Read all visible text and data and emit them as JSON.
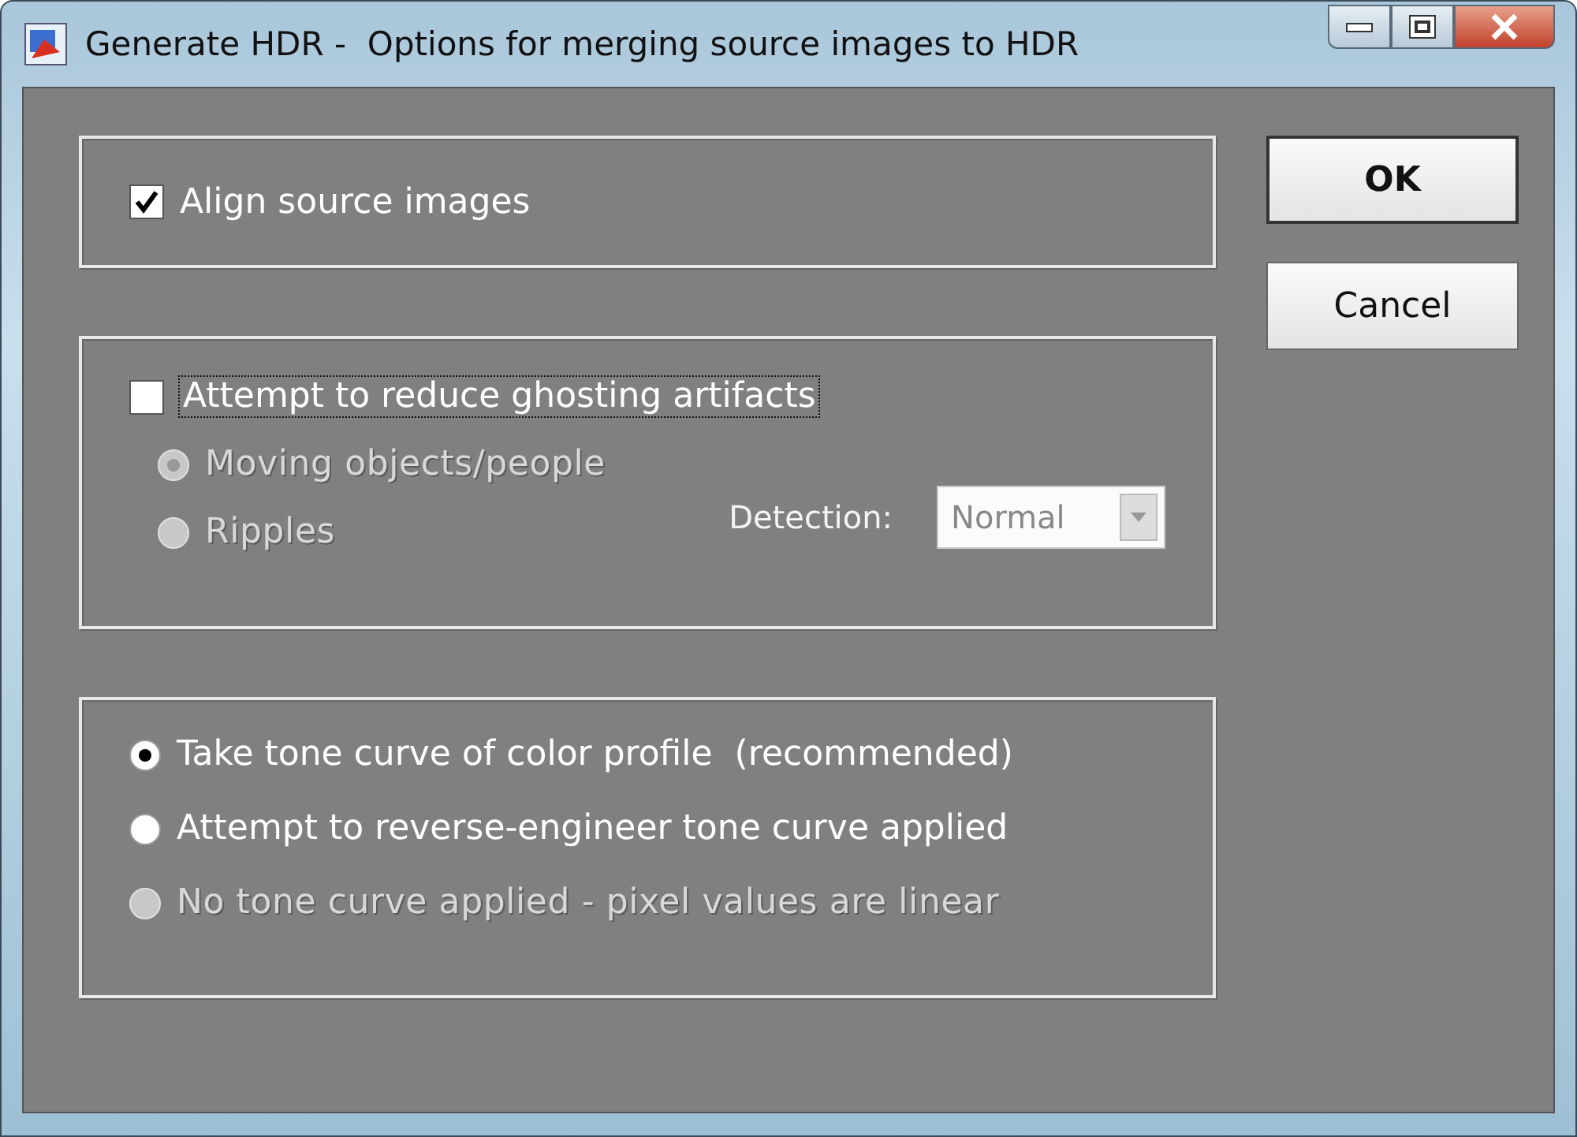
{
  "window": {
    "title": "Generate HDR -  Options for merging source images to HDR"
  },
  "align": {
    "label": "Align source images",
    "checked": true
  },
  "ghosting": {
    "label": "Attempt to reduce ghosting artifacts",
    "checked": false,
    "options": [
      {
        "label": "Moving objects/people",
        "selected": true,
        "disabled": true
      },
      {
        "label": "Ripples",
        "selected": false,
        "disabled": true
      }
    ],
    "detection": {
      "label": "Detection:",
      "value": "Normal",
      "disabled": true
    }
  },
  "tone_curve": [
    {
      "label": "Take tone curve of color profile  (recommended)",
      "selected": true,
      "disabled": false
    },
    {
      "label": "Attempt to reverse-engineer tone curve applied",
      "selected": false,
      "disabled": false
    },
    {
      "label": "No tone curve applied - pixel values are linear",
      "selected": false,
      "disabled": true
    }
  ],
  "buttons": [
    {
      "label": "OK",
      "default": true
    },
    {
      "label": "Cancel",
      "default": false
    }
  ]
}
